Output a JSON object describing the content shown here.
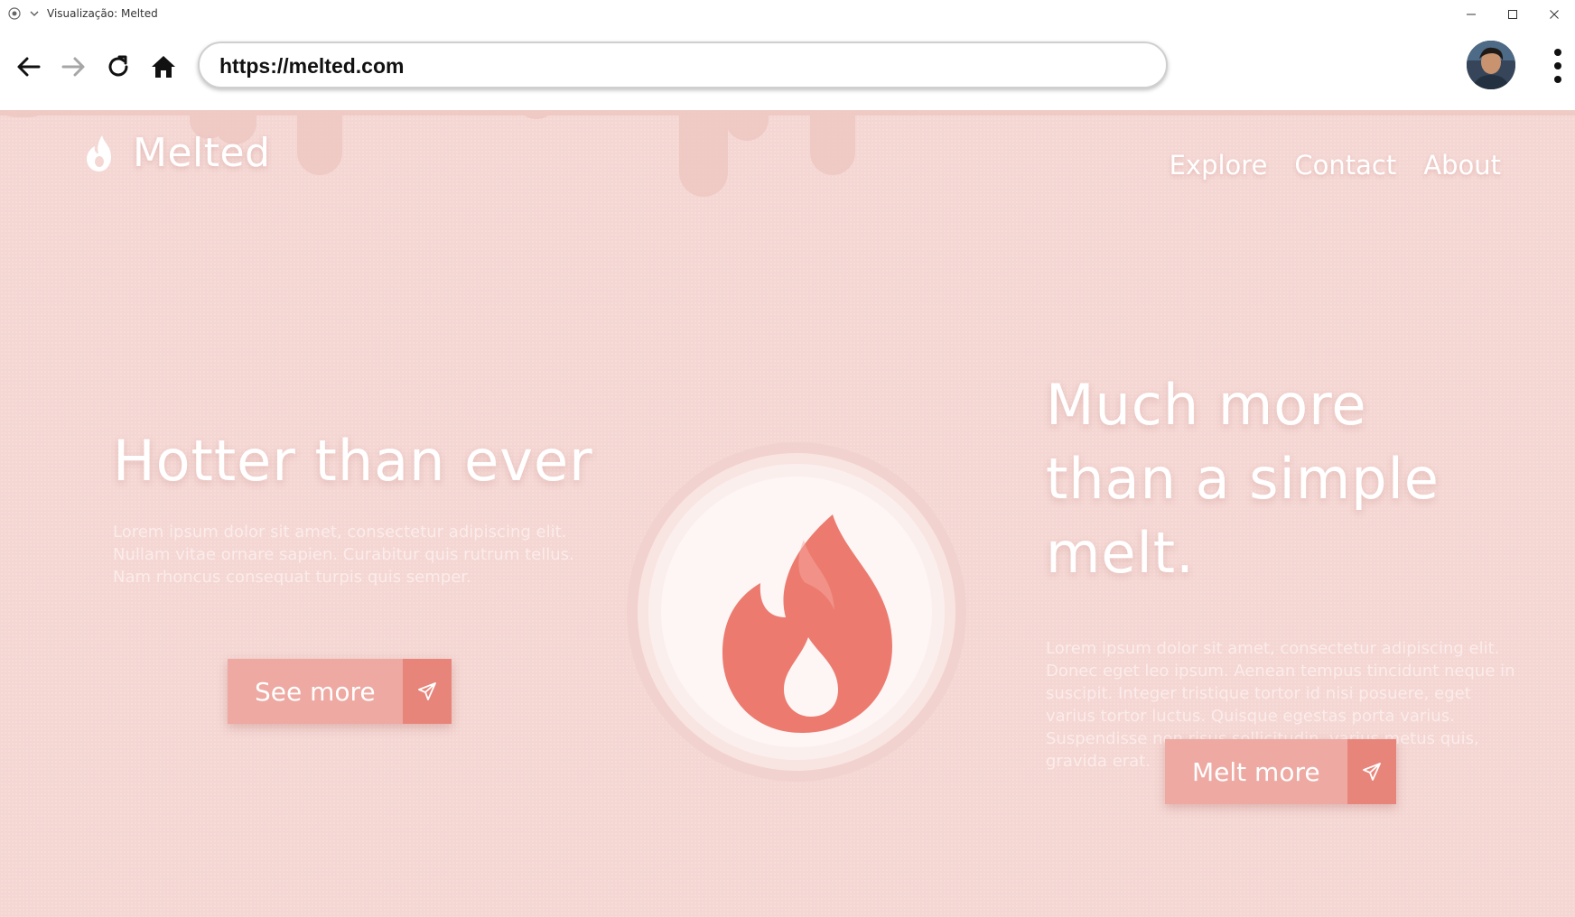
{
  "window": {
    "title": "Visualização: Melted"
  },
  "browser": {
    "url": "https://melted.com"
  },
  "site": {
    "brand": "Melted",
    "nav": [
      "Explore",
      "Contact",
      "About"
    ],
    "left": {
      "title": "Hotter than ever",
      "text": "Lorem ipsum dolor sit amet, consectetur adipiscing elit. Nullam vitae ornare sapien. Curabitur quis rutrum tellus. Nam rhoncus consequat turpis quis semper.",
      "button": "See more"
    },
    "right": {
      "title": "Much more than a simple melt.",
      "text": "Lorem ipsum dolor sit amet, consectetur adipiscing elit. Donec eget leo ipsum. Aenean tempus tincidunt neque in suscipit. Integer tristique tortor id nisi posuere, eget varius tortor luctus. Quisque egestas porta varius. Suspendisse non risus sollicitudin, varius metus quis, gravida erat.",
      "button": "Melt more"
    }
  },
  "colors": {
    "page_background": "#f4d6d2",
    "button": "#eda9a2",
    "button_accent": "#e8857b",
    "flame": "#ec7a6f"
  },
  "icons": [
    "window-icon",
    "chevron-down-icon",
    "minimize-icon",
    "maximize-icon",
    "close-icon",
    "back-arrow-icon",
    "forward-arrow-icon",
    "reload-icon",
    "home-icon",
    "kebab-menu-icon",
    "flame-icon",
    "send-icon"
  ]
}
